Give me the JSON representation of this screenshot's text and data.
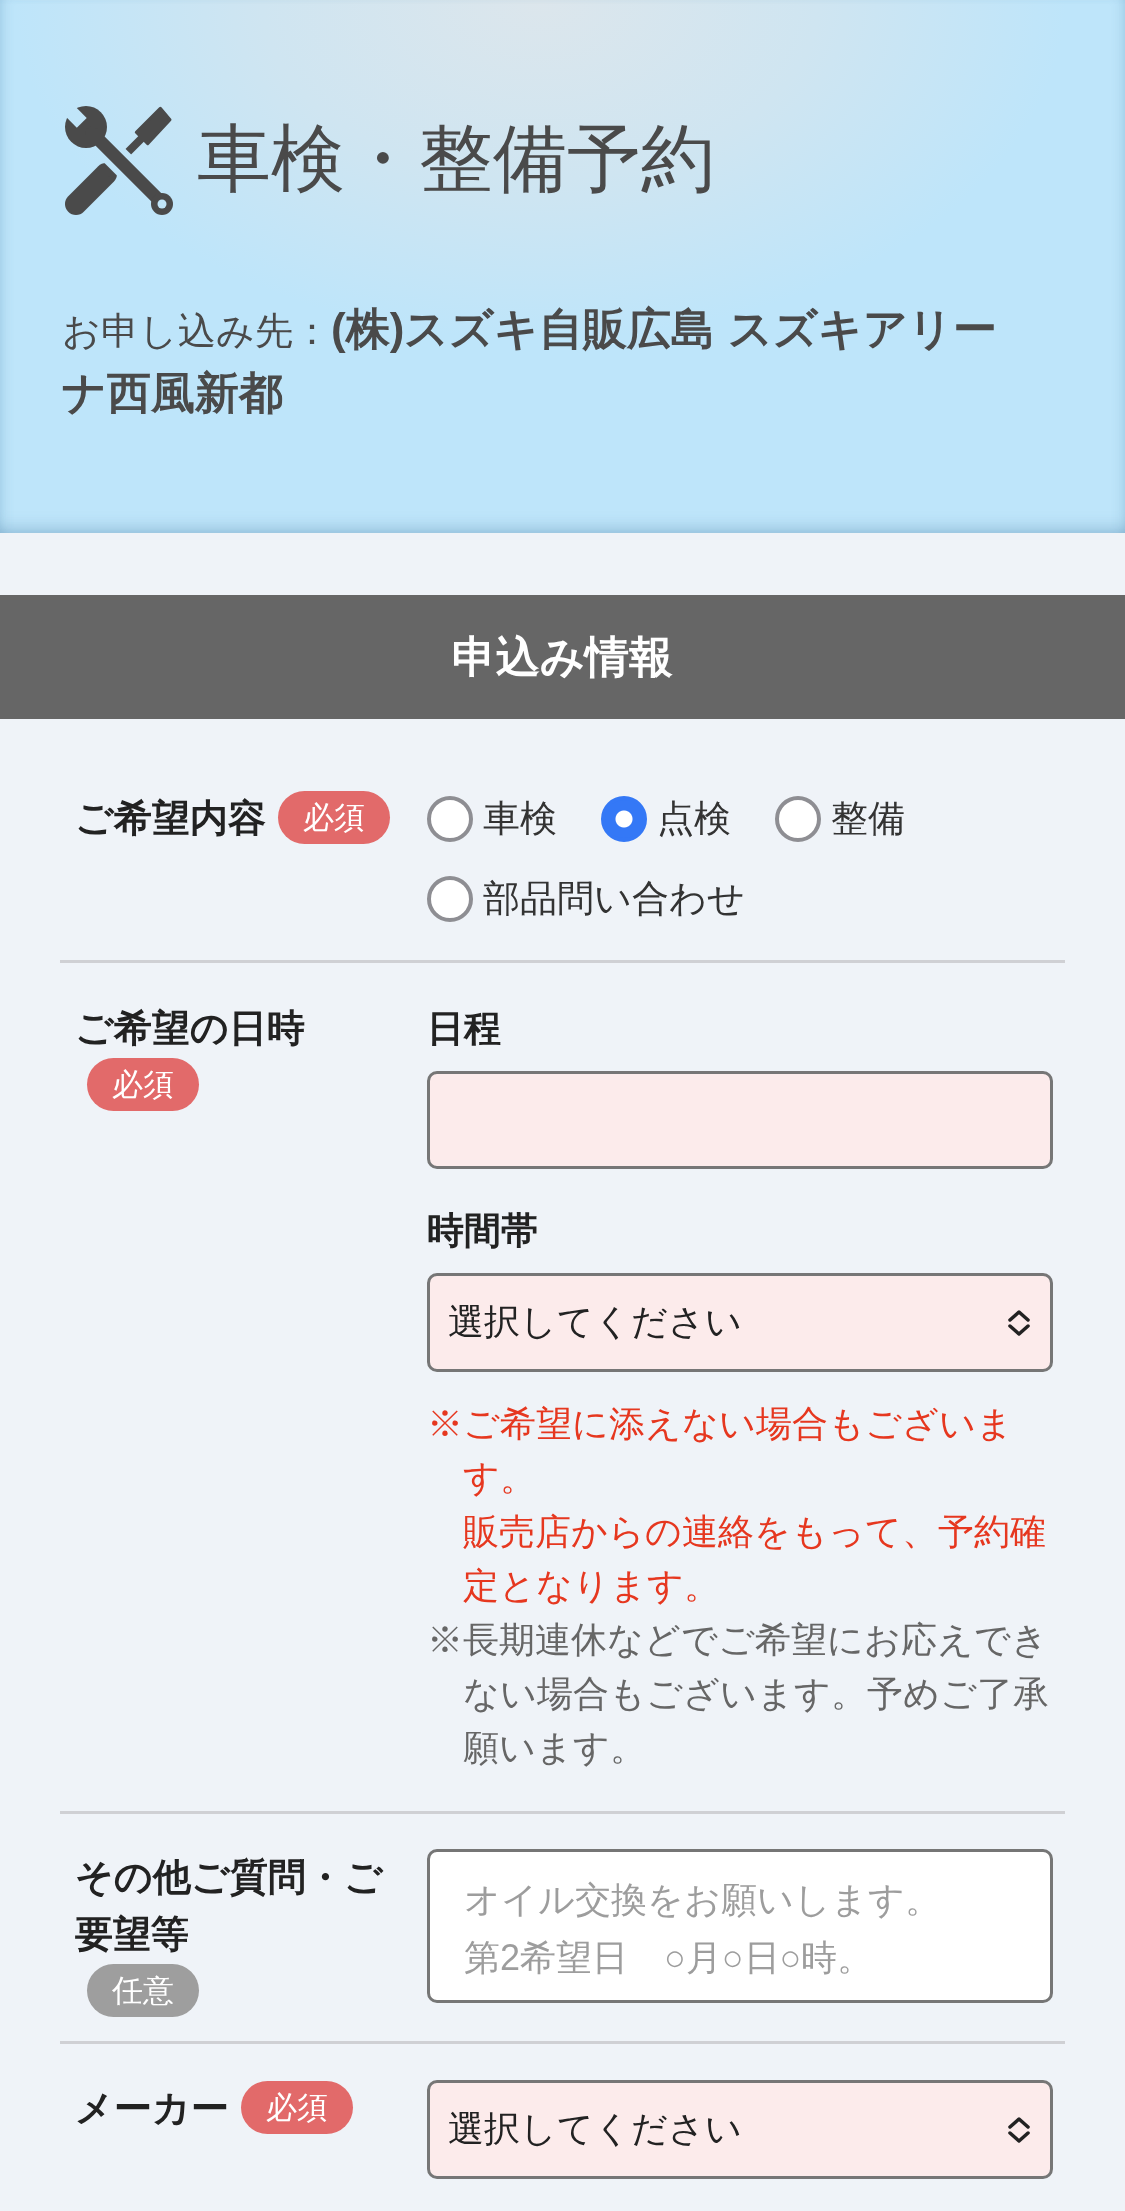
{
  "header": {
    "title": "車検・整備予約",
    "applicant": "お申し込み先：**(株)スズキ自販広島 スズキアリーナ西風新都**"
  },
  "section": {
    "title": "申込み情報"
  },
  "rows": [
    {
      "kind": "radio",
      "label": "ご希望内容",
      "tag": {
        "kind": "required",
        "text": "必須"
      },
      "options": [
        {
          "label": "車検",
          "selected": false
        },
        {
          "label": "点検",
          "selected": true
        },
        {
          "label": "整備",
          "selected": false
        },
        {
          "label": "部品問い合わせ",
          "selected": false
        }
      ]
    },
    {
      "kind": "datetime",
      "label": "ご希望の日時",
      "tag": {
        "kind": "required",
        "text": "必須"
      },
      "fields": [
        {
          "kind": "text",
          "label": "日程"
        },
        {
          "kind": "select",
          "label": "時間帯",
          "value": "選択してください"
        }
      ],
      "notes": [
        {
          "kind": "warning",
          "lines": [
            "※ご希望に添えない場合もございます。",
            "販売店からの連絡をもって、予約確定となります。"
          ]
        },
        {
          "kind": "info",
          "lines": [
            "※長期連休などでご希望にお応えできない場合もございます。予めご了承願います。"
          ]
        }
      ]
    },
    {
      "kind": "textarea",
      "label": "その他ご質問・ご要望等",
      "tag": {
        "kind": "optional",
        "text": "任意"
      },
      "placeholder": "オイル交換をお願いします。第2希望日　○月○日○時。"
    },
    {
      "kind": "select",
      "label": "メーカー",
      "tag": {
        "kind": "required",
        "text": "必須"
      },
      "value": "選択してください"
    }
  ]
}
